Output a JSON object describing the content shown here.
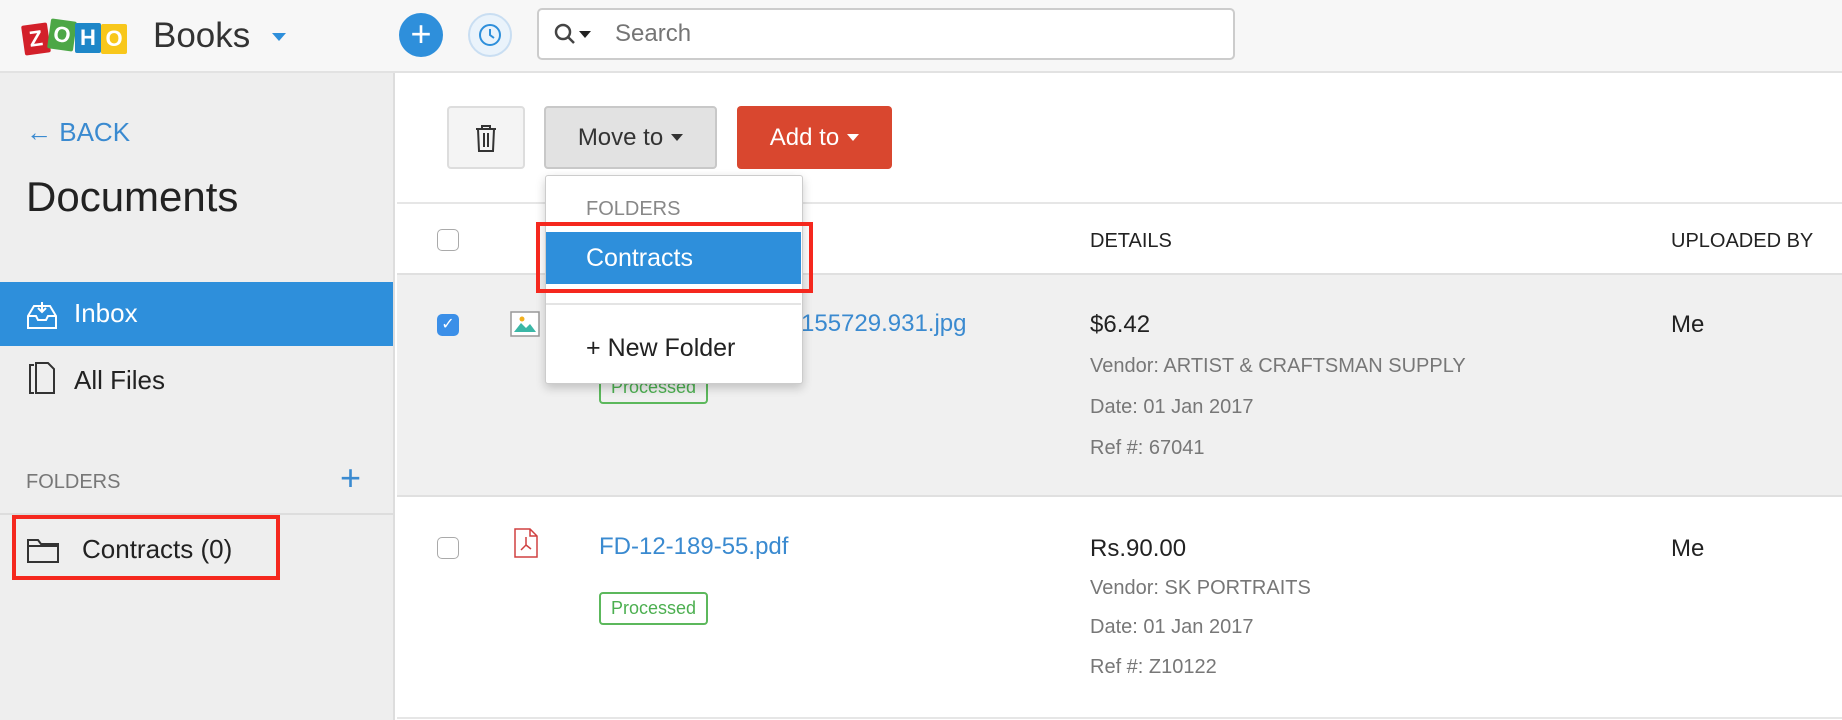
{
  "header": {
    "logo_letters": [
      "Z",
      "O",
      "H",
      "O"
    ],
    "app_name": "Books",
    "search_placeholder": "Search",
    "icons": {
      "new": "plus-icon",
      "recent": "history-clock-icon",
      "search": "search-icon"
    }
  },
  "sidebar": {
    "back_label": "BACK",
    "title": "Documents",
    "items": [
      {
        "label": "Inbox",
        "icon": "inbox-icon",
        "active": true
      },
      {
        "label": "All Files",
        "icon": "files-icon",
        "active": false
      }
    ],
    "folders_heading": "FOLDERS",
    "folders": [
      {
        "label": "Contracts (0)"
      }
    ]
  },
  "toolbar": {
    "move_label": "Move to",
    "add_label": "Add to"
  },
  "dropdown": {
    "heading": "FOLDERS",
    "items": [
      {
        "label": "Contracts",
        "highlighted": true
      }
    ],
    "new_folder_label": "New Folder"
  },
  "table": {
    "columns": [
      "DETAILS",
      "UPLOADED BY"
    ],
    "rows": [
      {
        "checked": true,
        "file_name": "155729.931.jpg",
        "file_type": "image",
        "status": "Processed",
        "amount": "$6.42",
        "vendor": "Vendor: ARTIST & CRAFTSMAN SUPPLY",
        "date": "Date: 01 Jan 2017",
        "ref": "Ref #: 67041",
        "uploaded_by": "Me"
      },
      {
        "checked": false,
        "file_name": "FD-12-189-55.pdf",
        "file_type": "pdf",
        "status": "Processed",
        "amount": "Rs.90.00",
        "vendor": "Vendor: SK PORTRAITS",
        "date": "Date: 01 Jan 2017",
        "ref": "Ref #: Z10122",
        "uploaded_by": "Me"
      }
    ]
  },
  "colors": {
    "accent": "#2e8fdb",
    "danger": "#d9472f",
    "link": "#3a8ad0",
    "success": "#4caf50",
    "highlight_box": "#f5281e"
  }
}
